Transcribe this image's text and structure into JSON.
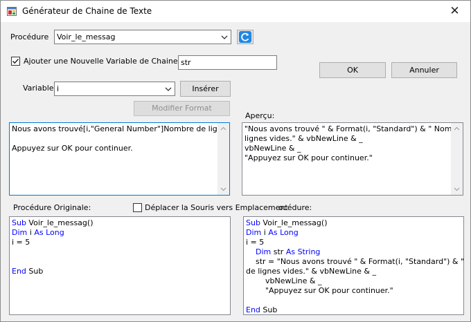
{
  "window": {
    "title": "Générateur de Chaine de Texte",
    "close_glyph": "✕"
  },
  "procedure": {
    "label": "Procédure",
    "value": "Voir_le_messag"
  },
  "add_variable": {
    "label": "Ajouter une Nouvelle Variable de Chaine de T",
    "checked": true,
    "value": "str"
  },
  "buttons": {
    "ok": "OK",
    "cancel": "Annuler",
    "insert": "Insérer",
    "format": "Modifier Format"
  },
  "variable": {
    "label": "Variable",
    "value": "i"
  },
  "editor": {
    "lines": [
      "Nous avons trouvé[i,\"General Number\"]Nombre de lignes vides.",
      "",
      "Appuyez sur OK pour continuer."
    ]
  },
  "preview": {
    "label": "Aperçu:",
    "lines": [
      "\"Nous avons trouvé \" & Format(i, \"Standard\") & \" Nombre de",
      "lignes vides.\" & vbNewLine & _",
      "vbNewLine & _",
      "\"Appuyez sur OK pour continuer.\""
    ]
  },
  "original": {
    "label": "Procédure Originale:",
    "lines": [
      [
        {
          "t": "Sub",
          "k": true
        },
        {
          "t": " Voir_le_messag()"
        }
      ],
      [
        {
          "t": "Dim",
          "k": true
        },
        {
          "t": " i "
        },
        {
          "t": "As Long",
          "k": true
        }
      ],
      [
        {
          "t": "i = 5"
        }
      ],
      [
        {
          "t": ""
        }
      ],
      [
        {
          "t": ""
        }
      ],
      [
        {
          "t": "End",
          "k": true
        },
        {
          "t": " Sub"
        }
      ]
    ]
  },
  "move_mouse": {
    "label": "Déplacer la Souris vers Emplacement",
    "checked": false
  },
  "new_proc_label_tail": "océdure:",
  "new_proc": {
    "lines": [
      [
        {
          "t": "Sub",
          "k": true
        },
        {
          "t": " Voir_le_messag()"
        }
      ],
      [
        {
          "t": "Dim",
          "k": true
        },
        {
          "t": " i "
        },
        {
          "t": "As Long",
          "k": true
        }
      ],
      [
        {
          "t": "i = 5"
        }
      ],
      [
        {
          "t": "    "
        },
        {
          "t": "Dim",
          "k": true
        },
        {
          "t": " str "
        },
        {
          "t": "As String",
          "k": true
        }
      ],
      [
        {
          "t": "    str = \"Nous avons trouvé \" & Format(i, \"Standard\") & \" Nombre"
        }
      ],
      [
        {
          "t": "de lignes vides.\" & vbNewLine & _"
        }
      ],
      [
        {
          "t": "        vbNewLine & _"
        }
      ],
      [
        {
          "t": "        \"Appuyez sur OK pour continuer.\""
        }
      ],
      [
        {
          "t": ""
        }
      ],
      [
        {
          "t": "End",
          "k": true
        },
        {
          "t": " Sub"
        }
      ]
    ]
  },
  "colors": {
    "accent": "#0078d7",
    "keyword": "#0000ff",
    "dialog_bg": "#f0f0f0"
  }
}
